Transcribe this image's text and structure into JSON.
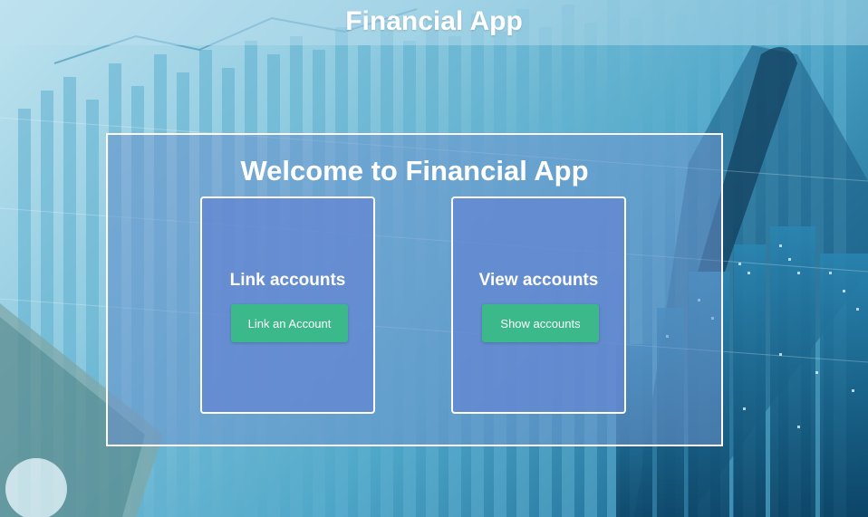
{
  "header": {
    "title": "Financial App"
  },
  "main": {
    "welcome": "Welcome to Financial App",
    "cards": [
      {
        "title": "Link accounts",
        "button_label": "Link an Account"
      },
      {
        "title": "View accounts",
        "button_label": "Show accounts"
      }
    ]
  },
  "colors": {
    "button": "#3bb98a",
    "card": "#6487d2",
    "panel": "#6e96cd"
  }
}
